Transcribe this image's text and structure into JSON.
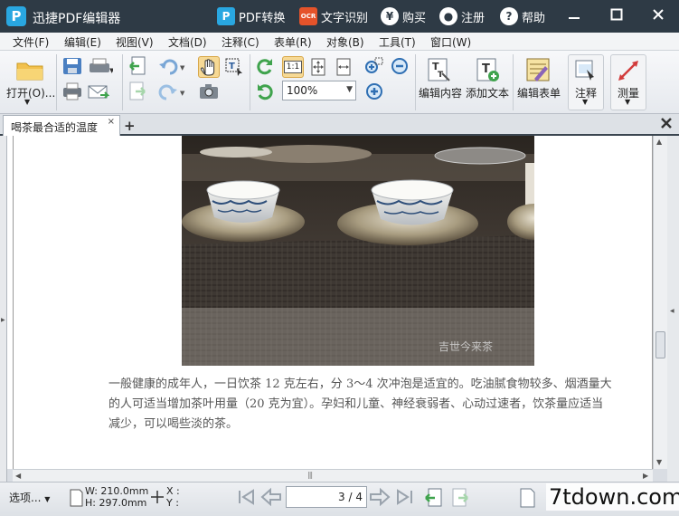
{
  "app": {
    "logo": "P",
    "title": "迅捷PDF编辑器"
  },
  "titlebar": {
    "pdf_convert": "PDF转换",
    "ocr_badge": "OCR",
    "ocr": "文字识别",
    "buy": "购买",
    "register": "注册",
    "help": "帮助"
  },
  "menu": [
    "文件(F)",
    "编辑(E)",
    "视图(V)",
    "文档(D)",
    "注释(C)",
    "表单(R)",
    "对象(B)",
    "工具(T)",
    "窗口(W)"
  ],
  "toolbar": {
    "open": "打开(O)...",
    "zoom": "100%",
    "actual_size": "1:1",
    "edit_content": "编辑内容",
    "add_text": "添加文本",
    "edit_form": "编辑表单",
    "annotate": "注释",
    "measure": "测量"
  },
  "tab": {
    "name": "喝茶最合适的温度",
    "close": "×",
    "add": "+"
  },
  "document": {
    "watermark": "吉世今来茶",
    "paragraph": "一般健康的成年人，一日饮茶 12 克左右，分 3～4 次冲泡是适宜的。吃油腻食物较多、烟酒量大的人可适当增加茶叶用量（20 克为宜）。孕妇和儿童、神经衰弱者、心动过速者，饮茶量应适当减少，可以喝些淡的茶。"
  },
  "statusbar": {
    "options": "选项...",
    "width": "W: 210.0mm",
    "height": "H: 297.0mm",
    "x": "X :",
    "y": "Y :",
    "page": "3 / 4"
  },
  "brand": "7tdown.com",
  "colors": {
    "titlebar": "#2e3a45",
    "accent": "#29a7e1"
  }
}
